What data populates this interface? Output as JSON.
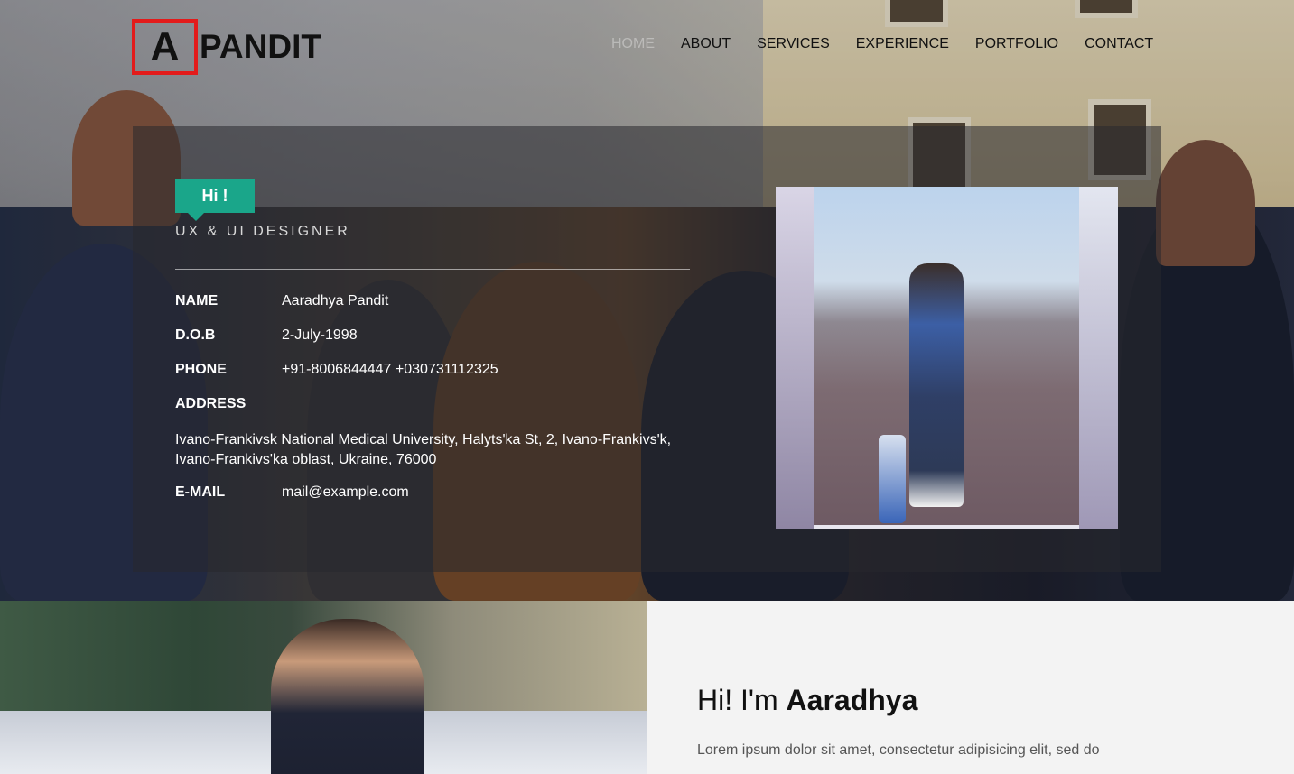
{
  "logo": {
    "letter": "A",
    "name": "PANDIT"
  },
  "nav": [
    {
      "label": "HOME",
      "active": true
    },
    {
      "label": "ABOUT"
    },
    {
      "label": "SERVICES"
    },
    {
      "label": "EXPERIENCE"
    },
    {
      "label": "PORTFOLIO"
    },
    {
      "label": "CONTACT"
    }
  ],
  "intro": {
    "badge": "Hi !",
    "role": "UX & UI DESIGNER"
  },
  "details": {
    "name": {
      "label": "NAME",
      "value": "Aaradhya Pandit"
    },
    "dob": {
      "label": "D.O.B",
      "value": "2-July-1998"
    },
    "phone": {
      "label": "PHONE",
      "value": "+91-8006844447 +030731112325"
    },
    "address": {
      "label": "ADDRESS",
      "value": "Ivano-Frankivsk National Medical University, Halyts'ka St, 2, Ivano-Frankivs'k, Ivano-Frankivs'ka oblast, Ukraine, 76000"
    },
    "email": {
      "label": "E-MAIL",
      "value": "mail@example.com"
    }
  },
  "about": {
    "greeting_prefix": "Hi! I'm ",
    "greeting_name": "Aaradhya",
    "text": "Lorem ipsum dolor sit amet, consectetur adipisicing elit, sed do"
  },
  "colors": {
    "accent": "#1aa68a",
    "logo_border": "#e31b1b"
  }
}
